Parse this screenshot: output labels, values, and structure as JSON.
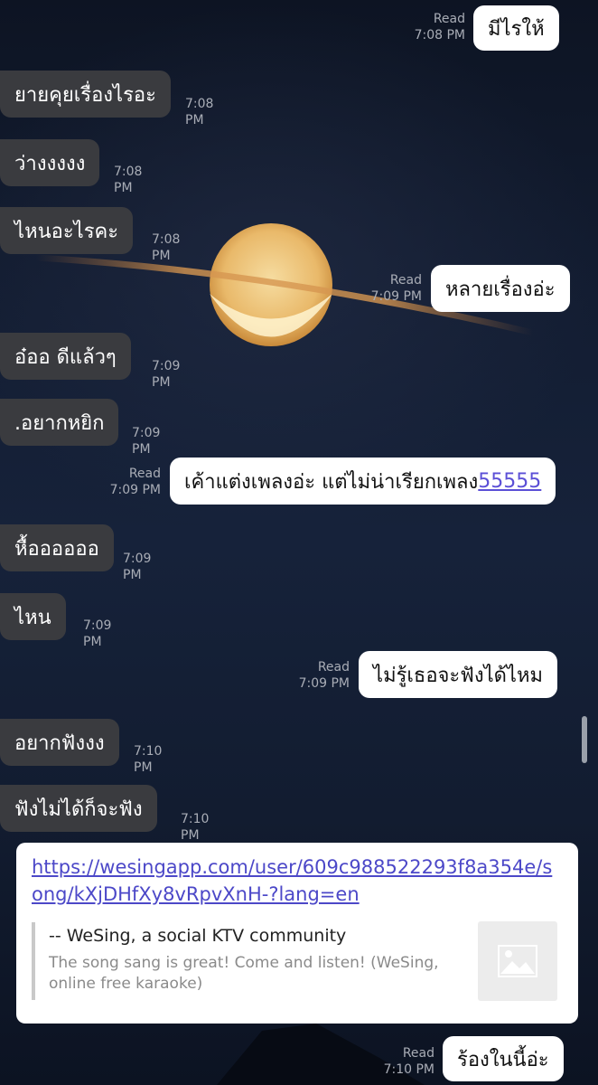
{
  "messages": [
    {
      "text": "มีไรให้",
      "status": "Read",
      "time": "7:08 PM"
    },
    {
      "text": "ยายคุยเรื่องไรอะ",
      "time": "7:08 PM"
    },
    {
      "text": "ว่างงงงง",
      "time": "7:08 PM"
    },
    {
      "text": "ไหนอะไรคะ",
      "time": "7:08 PM"
    },
    {
      "text": "หลายเรื่องอ่ะ",
      "status": "Read",
      "time": "7:09 PM"
    },
    {
      "text": "อ๋ออ ดีแล้วๆ",
      "time": "7:09 PM"
    },
    {
      "text": ".อยากหยิก",
      "time": "7:09 PM"
    },
    {
      "text_before": "เค้าแต่งเพลงอ่ะ  แต่ไม่น่าเรียกเพลง",
      "text_link": "55555",
      "status": "Read",
      "time": "7:09 PM"
    },
    {
      "text": "หื้ออออออ",
      "time": "7:09 PM"
    },
    {
      "text": "ไหน",
      "time": "7:09 PM"
    },
    {
      "text": "ไม่รู้เธอจะฟังได้ไหม",
      "status": "Read",
      "time": "7:09 PM"
    },
    {
      "text": "อยากฟังงง",
      "time": "7:10 PM"
    },
    {
      "text": "ฟังไม่ได้ก็จะฟัง",
      "time": "7:10 PM"
    },
    {
      "text": "ร้องในนี้อ่ะ",
      "status": "Read",
      "time": "7:10 PM"
    }
  ],
  "link_card": {
    "url": "https://wesingapp.com/user/609c988522293f8a354e/song/kXjDHfXy8vRpvXnH-?lang=en",
    "title": "-- WeSing, a social KTV community",
    "description": "The song sang is great! Come and listen! (WeSing, online free karaoke)",
    "thumbnail_icon": "image-placeholder-icon"
  }
}
